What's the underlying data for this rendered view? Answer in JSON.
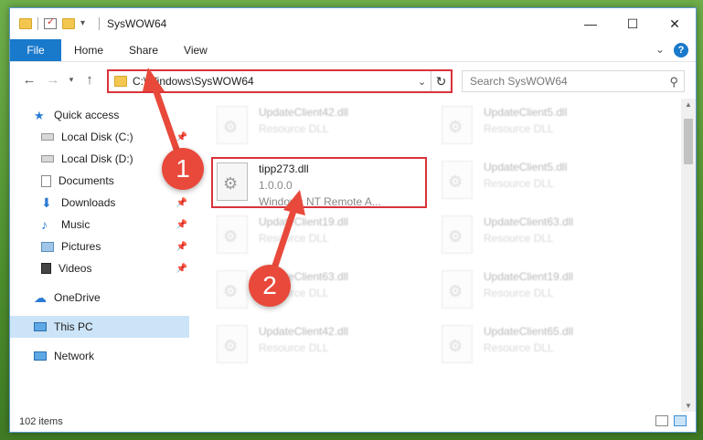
{
  "window": {
    "title": "SysWOW64"
  },
  "ribbon": {
    "tabs": [
      "File",
      "Home",
      "Share",
      "View"
    ]
  },
  "address": {
    "path": "C:\\Windows\\SysWOW64"
  },
  "search": {
    "placeholder": "Search SysWOW64"
  },
  "sidebar": {
    "items": [
      {
        "label": "Quick access",
        "icon": "star-icon",
        "pinned": false
      },
      {
        "label": "Local Disk (C:)",
        "icon": "drive-icon",
        "pinned": true
      },
      {
        "label": "Local Disk (D:)",
        "icon": "drive-icon",
        "pinned": false
      },
      {
        "label": "Documents",
        "icon": "documents-icon",
        "pinned": true
      },
      {
        "label": "Downloads",
        "icon": "download-icon",
        "pinned": true
      },
      {
        "label": "Music",
        "icon": "music-icon",
        "pinned": true
      },
      {
        "label": "Pictures",
        "icon": "pictures-icon",
        "pinned": true
      },
      {
        "label": "Videos",
        "icon": "videos-icon",
        "pinned": true
      },
      {
        "label": "OneDrive",
        "icon": "cloud-icon",
        "pinned": false
      },
      {
        "label": "This PC",
        "icon": "computer-icon",
        "pinned": false,
        "selected": true
      },
      {
        "label": "Network",
        "icon": "network-icon",
        "pinned": false
      }
    ]
  },
  "files": {
    "highlighted": {
      "name": "tipp273.dll",
      "version": "1.0.0.0",
      "description": "Windows NT Remote A..."
    },
    "background": [
      {
        "name": "UpdateClient42.dll",
        "type": "Resource DLL"
      },
      {
        "name": "UpdateClient5.dll",
        "type": "Resource DLL"
      },
      {
        "name": "UpdateClient5.dll",
        "type": "Resource DLL"
      },
      {
        "name": "UpdateClient19.dll",
        "type": "Resource DLL"
      },
      {
        "name": "UpdateClient63.dll",
        "type": "Resource DLL"
      },
      {
        "name": "UpdateClient63.dll",
        "type": "Resource DLL"
      },
      {
        "name": "UpdateClient19.dll",
        "type": "Resource DLL"
      },
      {
        "name": "UpdateClient42.dll",
        "type": "Resource DLL"
      },
      {
        "name": "UpdateClient65.dll",
        "type": "Resource DLL"
      }
    ]
  },
  "status": {
    "items": "102 items"
  },
  "callouts": [
    "1",
    "2"
  ],
  "colors": {
    "accent": "#1979ca",
    "highlight": "#d9323a",
    "callout": "#e8493b"
  }
}
